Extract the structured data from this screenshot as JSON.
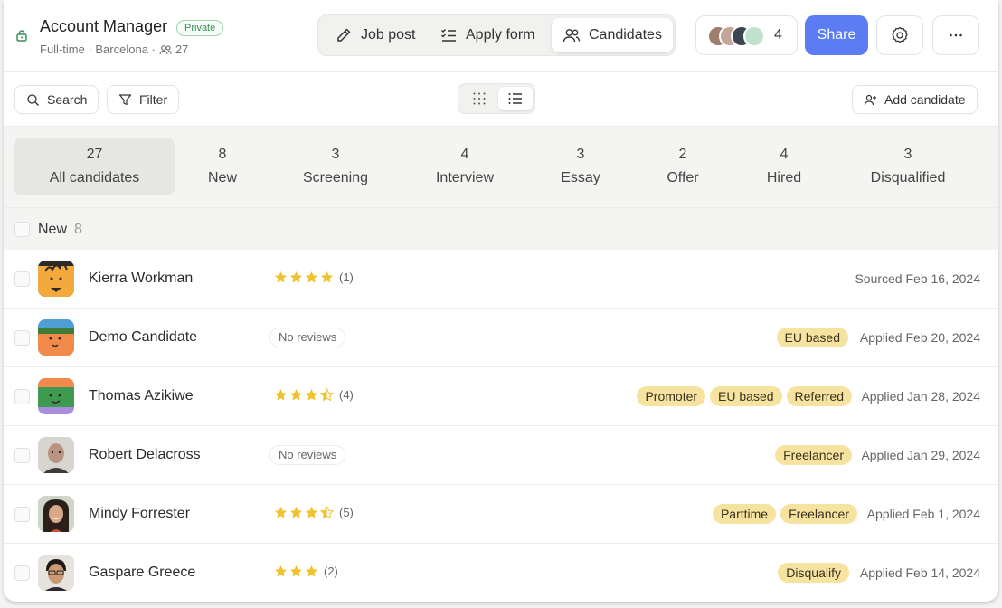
{
  "header": {
    "title": "Account Manager",
    "privacy_badge": "Private",
    "meta": "Full-time · Barcelona ·",
    "members_count": "27",
    "tabs": [
      {
        "label": "Job post",
        "icon": "pencil-icon"
      },
      {
        "label": "Apply form",
        "icon": "checklist-icon"
      },
      {
        "label": "Candidates",
        "icon": "users-icon",
        "active": true
      }
    ],
    "collaborators_count": "4",
    "share_label": "Share",
    "accent_color": "#5b7cf3"
  },
  "toolbar": {
    "search_label": "Search",
    "filter_label": "Filter",
    "add_candidate_label": "Add candidate",
    "views": [
      "grid",
      "list"
    ],
    "active_view": "list"
  },
  "stages": [
    {
      "count": "27",
      "label": "All candidates",
      "active": true
    },
    {
      "count": "8",
      "label": "New"
    },
    {
      "count": "3",
      "label": "Screening"
    },
    {
      "count": "4",
      "label": "Interview"
    },
    {
      "count": "3",
      "label": "Essay"
    },
    {
      "count": "2",
      "label": "Offer"
    },
    {
      "count": "4",
      "label": "Hired"
    },
    {
      "count": "3",
      "label": "Disqualified"
    }
  ],
  "group": {
    "label": "New",
    "count": "8"
  },
  "candidates": [
    {
      "name": "Kierra Workman",
      "rating": 4,
      "reviews": "(1)",
      "tags": [],
      "date": "Sourced Feb 16, 2024"
    },
    {
      "name": "Demo Candidate",
      "rating": 0,
      "no_reviews": "No reviews",
      "tags": [
        "EU based"
      ],
      "date": "Applied Feb 20, 2024"
    },
    {
      "name": "Thomas Azikiwe",
      "rating": 3.5,
      "reviews": "(4)",
      "tags": [
        "Promoter",
        "EU based",
        "Referred"
      ],
      "date": "Applied Jan 28, 2024"
    },
    {
      "name": "Robert Delacross",
      "rating": 0,
      "no_reviews": "No reviews",
      "tags": [
        "Freelancer"
      ],
      "date": "Applied Jan 29, 2024"
    },
    {
      "name": "Mindy Forrester",
      "rating": 3.5,
      "reviews": "(5)",
      "tags": [
        "Parttime",
        "Freelancer"
      ],
      "date": "Applied Feb 1, 2024"
    },
    {
      "name": "Gaspare Greece",
      "rating": 3,
      "reviews": "(2)",
      "tags": [
        "Disqualify"
      ],
      "date": "Applied Feb 14, 2024"
    }
  ],
  "colors": {
    "tag": "#f7e3a0",
    "star": "#f2c12e",
    "private": "#3c8d5a"
  }
}
